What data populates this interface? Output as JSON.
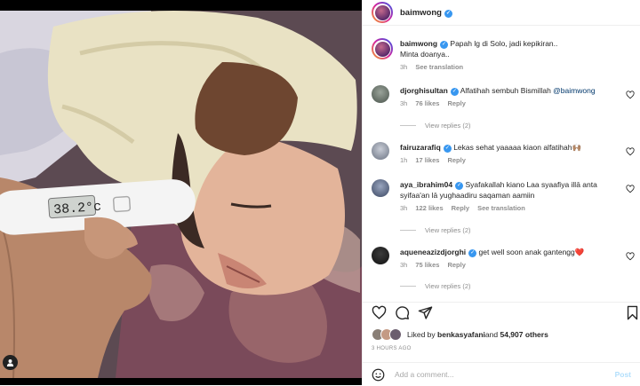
{
  "post": {
    "author": "baimwong",
    "caption_line1": "Papah lg di Solo, jadi kepikiran..",
    "caption_line2": "Minta doanya..",
    "caption_time": "3h",
    "see_translation": "See translation",
    "thermometer_reading": "38.2°c"
  },
  "comments": [
    {
      "user": "djorghisultan",
      "text_before": "Alfatihah sembuh Bismillah ",
      "mention": "@baimwong",
      "time": "3h",
      "likes": "76 likes",
      "reply": "Reply",
      "view_replies": "View replies (2)"
    },
    {
      "user": "fairuzarafiq",
      "text": "Lekas sehat yaaaaa kiaon alfatihah🙌🏽",
      "time": "1h",
      "likes": "17 likes",
      "reply": "Reply"
    },
    {
      "user": "aya_ibrahim04",
      "text": "Syafakallah kiano Laa syaafiya illā anta syifaa'an lā yughaadiru saqaman aamiin",
      "time": "3h",
      "likes": "122 likes",
      "reply": "Reply",
      "see_translation": "See translation",
      "view_replies": "View replies (2)"
    },
    {
      "user": "aqueneazizdjorghi",
      "text": "get well soon anak gantengg❤️",
      "time": "3h",
      "likes": "75 likes",
      "reply": "Reply",
      "view_replies": "View replies (2)"
    }
  ],
  "likes": {
    "prefix": "Liked by ",
    "user": "benkasyafani",
    "middle": " and ",
    "count": "54,907 others"
  },
  "posted_ago": "3 HOURS AGO",
  "add_comment": {
    "placeholder": "Add a comment...",
    "post_label": "Post"
  },
  "colors": {
    "verified": "#3897f0",
    "link": "#00376b",
    "post_disabled": "#b2dffc",
    "muted": "#8e8e8e"
  },
  "icons": [
    "heart-icon",
    "comment-icon",
    "share-icon",
    "bookmark-icon",
    "emoji-icon",
    "user-tag-icon",
    "verified-icon"
  ]
}
